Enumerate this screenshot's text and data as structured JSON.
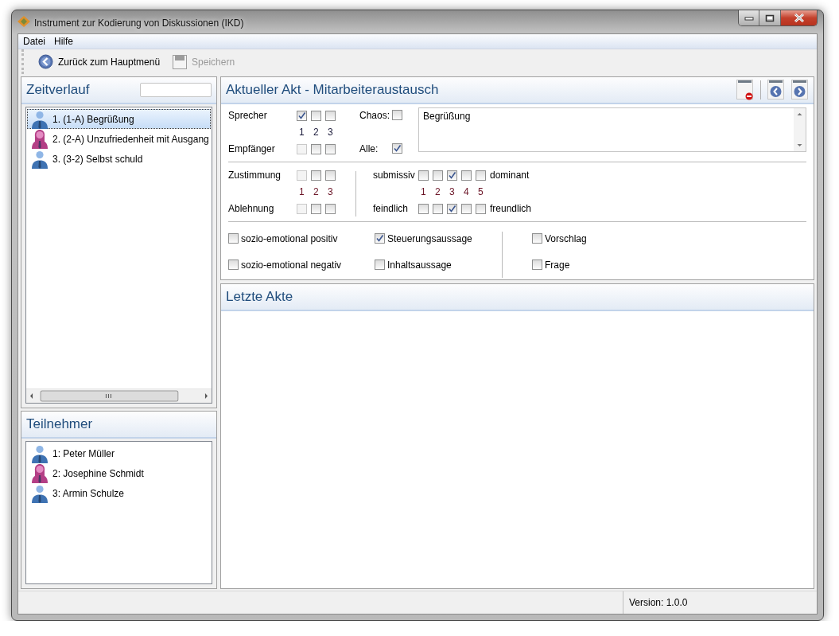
{
  "window": {
    "title": "Instrument zur Kodierung von Diskussionen (IKD)"
  },
  "menu": [
    {
      "label": "Datei"
    },
    {
      "label": "Hilfe"
    }
  ],
  "toolbar": [
    {
      "kind": "back",
      "label": "Zurück zum Hauptmenü",
      "disabled": false
    },
    {
      "kind": "save",
      "label": "Speichern",
      "disabled": true
    }
  ],
  "timeline": {
    "title": "Zeitverlauf",
    "items": [
      {
        "label": "1. (1-A) Begrüßung",
        "kind": "male",
        "selected": true
      },
      {
        "label": "2. (2-A) Unzufriedenheit mit Ausgang",
        "kind": "female",
        "selected": false
      },
      {
        "label": "3. (3-2) Selbst schuld",
        "kind": "male",
        "selected": false
      }
    ]
  },
  "participants": {
    "title": "Teilnehmer",
    "items": [
      {
        "label": "1: Peter Müller",
        "kind": "male"
      },
      {
        "label": "2: Josephine Schmidt",
        "kind": "female"
      },
      {
        "label": "3: Armin Schulze",
        "kind": "male"
      }
    ]
  },
  "act": {
    "title": "Aktueller Akt - Mitarbeiteraustausch",
    "speaker": {
      "label": "Sprecher",
      "boxes": [
        {
          "checked": true,
          "disabled": false
        },
        {
          "checked": false,
          "disabled": false
        },
        {
          "checked": false,
          "disabled": false
        }
      ]
    },
    "person_numbers": [
      "1",
      "2",
      "3"
    ],
    "receiver": {
      "label": "Empfänger",
      "boxes": [
        {
          "checked": false,
          "disabled": true
        },
        {
          "checked": false,
          "disabled": false
        },
        {
          "checked": false,
          "disabled": false
        }
      ]
    },
    "chaos": {
      "label": "Chaos:",
      "checked": false
    },
    "all": {
      "label": "Alle:",
      "checked": true
    },
    "note": "Begrüßung",
    "agreement": {
      "label": "Zustimmung",
      "boxes": [
        {
          "checked": false,
          "disabled": true
        },
        {
          "checked": false,
          "disabled": false
        },
        {
          "checked": false,
          "disabled": false
        }
      ]
    },
    "agreement_numbers": [
      "1",
      "2",
      "3"
    ],
    "rejection": {
      "label": "Ablehnung",
      "boxes": [
        {
          "checked": false,
          "disabled": true
        },
        {
          "checked": false,
          "disabled": false
        },
        {
          "checked": false,
          "disabled": false
        }
      ]
    },
    "dominance": {
      "left": "submissiv",
      "right": "dominant",
      "boxes": [
        {
          "checked": false
        },
        {
          "checked": false
        },
        {
          "checked": true
        },
        {
          "checked": false
        },
        {
          "checked": false
        }
      ]
    },
    "scale_numbers": [
      "1",
      "2",
      "3",
      "4",
      "5"
    ],
    "friendliness": {
      "left": "feindlich",
      "right": "freundlich",
      "boxes": [
        {
          "checked": false
        },
        {
          "checked": false
        },
        {
          "checked": true
        },
        {
          "checked": false
        },
        {
          "checked": false
        }
      ]
    },
    "categories": [
      {
        "items": [
          {
            "label": "sozio-emotional positiv",
            "checked": false
          },
          {
            "label": "sozio-emotional negativ",
            "checked": false
          }
        ]
      },
      {
        "items": [
          {
            "label": "Steuerungsaussage",
            "checked": true
          },
          {
            "label": "Inhaltsaussage",
            "checked": false
          }
        ]
      },
      {
        "items": [
          {
            "label": "Vorschlag",
            "checked": false
          },
          {
            "label": "Frage",
            "checked": false
          }
        ]
      }
    ]
  },
  "recent": {
    "title": "Letzte Akte"
  },
  "status_bar": {
    "version": "Version: 1.0.0"
  }
}
